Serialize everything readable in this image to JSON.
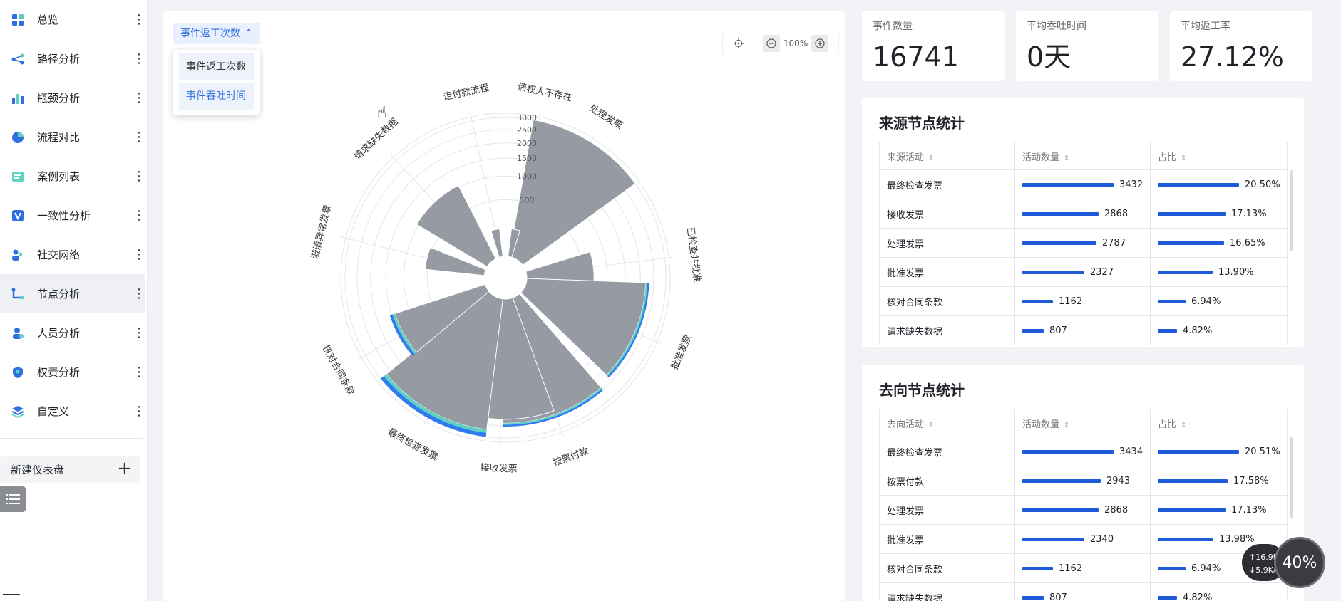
{
  "sidebar": {
    "items": [
      {
        "label": "总览",
        "icon": "grid-icon",
        "active": false
      },
      {
        "label": "路径分析",
        "icon": "path-icon",
        "active": false
      },
      {
        "label": "瓶颈分析",
        "icon": "bar-chart-icon",
        "active": false
      },
      {
        "label": "流程对比",
        "icon": "pie-icon",
        "active": false
      },
      {
        "label": "案例列表",
        "icon": "case-list-icon",
        "active": false
      },
      {
        "label": "一致性分析",
        "icon": "consistency-icon",
        "active": false
      },
      {
        "label": "社交网络",
        "icon": "people-icon",
        "active": false
      },
      {
        "label": "节点分析",
        "icon": "node-icon",
        "active": true
      },
      {
        "label": "人员分析",
        "icon": "person-icon",
        "active": false
      },
      {
        "label": "权责分析",
        "icon": "shield-icon",
        "active": false
      },
      {
        "label": "自定义",
        "icon": "layers-icon",
        "active": false
      }
    ],
    "more_glyph": "⋮",
    "new_dashboard_label": "新建仪表盘",
    "new_dashboard_plus": "+"
  },
  "chart_panel": {
    "dropdown": {
      "selected": "事件返工次数",
      "options": [
        "事件返工次数",
        "事件吞吐时间"
      ]
    },
    "zoom_level": "100%"
  },
  "kpis": [
    {
      "label": "事件数量",
      "value": "16741"
    },
    {
      "label": "平均吞吐时间",
      "value": "0天"
    },
    {
      "label": "平均返工率",
      "value": "27.12%"
    }
  ],
  "source_stats": {
    "title": "来源节点统计",
    "headers": [
      "来源活动",
      "活动数量",
      "占比"
    ],
    "rows": [
      {
        "activity": "最终检查发票",
        "count": "3432",
        "ratio": "20.50%",
        "count_frac": 1.0,
        "ratio_frac": 1.0
      },
      {
        "activity": "接收发票",
        "count": "2868",
        "ratio": "17.13%",
        "count_frac": 0.836,
        "ratio_frac": 0.836
      },
      {
        "activity": "处理发票",
        "count": "2787",
        "ratio": "16.65%",
        "count_frac": 0.812,
        "ratio_frac": 0.812
      },
      {
        "activity": "批准发票",
        "count": "2327",
        "ratio": "13.90%",
        "count_frac": 0.678,
        "ratio_frac": 0.678
      },
      {
        "activity": "核对合同条款",
        "count": "1162",
        "ratio": "6.94%",
        "count_frac": 0.339,
        "ratio_frac": 0.339
      },
      {
        "activity": "请求缺失数据",
        "count": "807",
        "ratio": "4.82%",
        "count_frac": 0.235,
        "ratio_frac": 0.235
      }
    ]
  },
  "target_stats": {
    "title": "去向节点统计",
    "headers": [
      "去向活动",
      "活动数量",
      "占比"
    ],
    "rows": [
      {
        "activity": "最终检查发票",
        "count": "3434",
        "ratio": "20.51%",
        "count_frac": 1.0,
        "ratio_frac": 1.0
      },
      {
        "activity": "按票付款",
        "count": "2943",
        "ratio": "17.58%",
        "count_frac": 0.857,
        "ratio_frac": 0.857
      },
      {
        "activity": "处理发票",
        "count": "2868",
        "ratio": "17.13%",
        "count_frac": 0.835,
        "ratio_frac": 0.835
      },
      {
        "activity": "批准发票",
        "count": "2340",
        "ratio": "13.98%",
        "count_frac": 0.681,
        "ratio_frac": 0.681
      },
      {
        "activity": "核对合同条款",
        "count": "1162",
        "ratio": "6.94%",
        "count_frac": 0.338,
        "ratio_frac": 0.338
      },
      {
        "activity": "请求缺失数据",
        "count": "807",
        "ratio": "4.82%",
        "count_frac": 0.235,
        "ratio_frac": 0.235
      }
    ]
  },
  "overlay": {
    "upload": "16.9K/s",
    "download": "5.9K/s",
    "gauge": "40%"
  },
  "colors": {
    "accent": "#2f6fe0",
    "bar": "#1f5bd8",
    "sector": "#969ba3",
    "rework_blue": "#2f7bf0",
    "rework_teal": "#5ed2c2"
  },
  "chart_data": {
    "type": "polar-bar",
    "categories": [
      "处理发票",
      "已检查并批准",
      "批准发票",
      "按票付款",
      "接收发票",
      "最终检查发票",
      "核对合同条款",
      "澄清异常发票",
      "请求缺失数据",
      "走付款流程",
      "债权人不存在"
    ],
    "values": [
      3000,
      700,
      2200,
      2400,
      2250,
      2700,
      1400,
      550,
      1050,
      120,
      120
    ],
    "rework_layers": [
      {
        "name": "",
        "values": [
          0,
          0,
          60,
          60,
          0,
          180,
          120,
          0,
          0,
          0,
          0
        ]
      }
    ],
    "radial_ticks": [
      "500",
      "1000",
      "1500",
      "2000",
      "2500",
      "3000"
    ],
    "rlim": [
      0,
      3000
    ]
  }
}
